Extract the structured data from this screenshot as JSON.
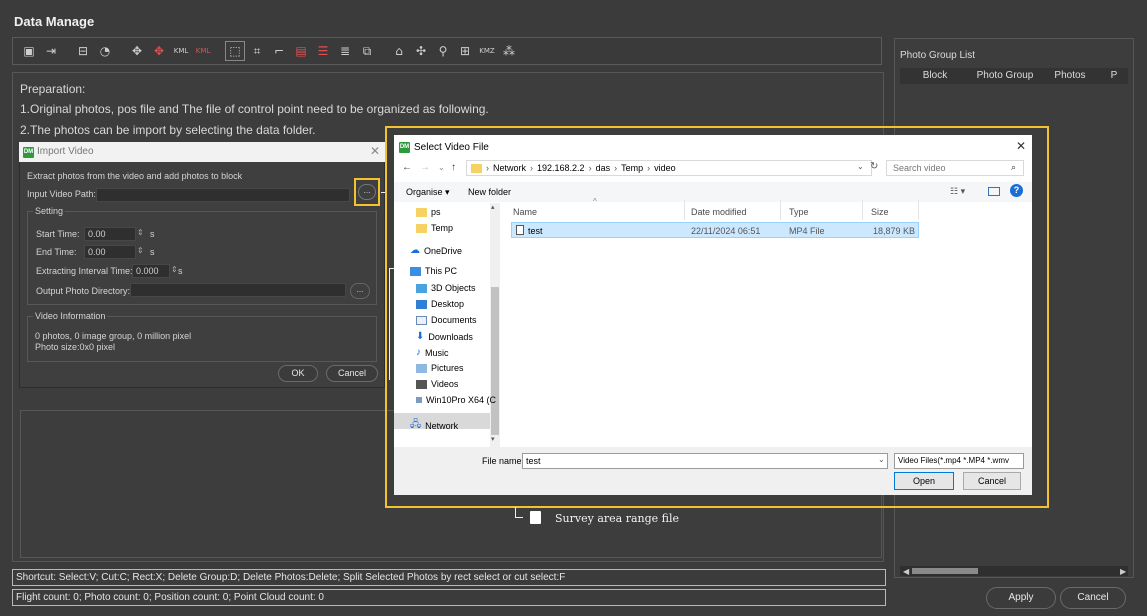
{
  "window": {
    "title": "Data Manage"
  },
  "toolbar": {
    "icons": [
      "image-icon",
      "import-icon",
      "layers-icon",
      "pie-icon",
      "target-icon",
      "target-red-icon",
      "kml-icon",
      "kml-red-icon",
      "select-icon",
      "crop-icon",
      "cut-icon",
      "photo-red-icon",
      "stack-red-icon",
      "list-icon",
      "image-edit-icon",
      "home-icon",
      "move-icon",
      "marker-icon",
      "gallery-icon",
      "kmz-icon",
      "grid-icon"
    ]
  },
  "preparation": {
    "heading": "Preparation:",
    "line1": "1.Original photos, pos file and The file of control point need to be organized as following.",
    "line2": "2.The photos can be import by selecting the data folder."
  },
  "import_dialog": {
    "title": "Import Video",
    "description": "Extract photos from the video and add photos to block",
    "input_path_label": "Input Video Path:",
    "browse_label": "...",
    "setting_label": "Setting",
    "start_time_label": "Start Time:",
    "start_time_value": "0.00",
    "end_time_label": "End Time:",
    "end_time_value": "0.00",
    "unit_s": "s",
    "interval_label": "Extracting Interval Time:",
    "interval_value": "0.000",
    "output_dir_label": "Output Photo Directory:",
    "video_info_label": "Video Information",
    "info_line1": "0 photos, 0 image group, 0 million pixel",
    "info_line2": "Photo size:0x0 pixel",
    "ok_label": "OK",
    "cancel_label": "Cancel"
  },
  "file_dialog": {
    "title": "Select Video File",
    "breadcrumb": [
      "Network",
      "192.168.2.2",
      "das",
      "Temp",
      "video"
    ],
    "search_placeholder": "Search video",
    "organise_label": "Organise ▾",
    "new_folder_label": "New folder",
    "sidebar": [
      "ps",
      "Temp",
      "OneDrive",
      "This PC",
      "3D Objects",
      "Desktop",
      "Documents",
      "Downloads",
      "Music",
      "Pictures",
      "Videos",
      "Win10Pro X64 (C",
      "Network"
    ],
    "columns": {
      "name": "Name",
      "date": "Date modified",
      "type": "Type",
      "size": "Size"
    },
    "files": [
      {
        "name": "test",
        "date": "22/11/2024 06:51",
        "type": "MP4 File",
        "size": "18,879 KB"
      }
    ],
    "file_name_label": "File name:",
    "file_name_value": "test",
    "filter_value": "Video Files(*.mp4 *.MP4 *.wmv",
    "open_label": "Open",
    "cancel_label": "Cancel"
  },
  "annotation": {
    "label": "Survey area range file"
  },
  "status": {
    "shortcut": "Shortcut: Select:V; Cut:C; Rect:X; Delete Group:D; Delete Photos:Delete; Split Selected Photos by rect select or cut select:F",
    "counts": "Flight count: 0; Photo count: 0; Position count: 0; Point Cloud count: 0"
  },
  "photo_group_list": {
    "title": "Photo Group List",
    "columns": [
      "Block",
      "Photo Group",
      "Photos",
      "P"
    ]
  },
  "footer": {
    "apply_label": "Apply",
    "cancel_label": "Cancel"
  },
  "colors": {
    "highlight": "#f2c230",
    "selected_row": "#cce8ff",
    "app_green": "#2e9a3e"
  }
}
